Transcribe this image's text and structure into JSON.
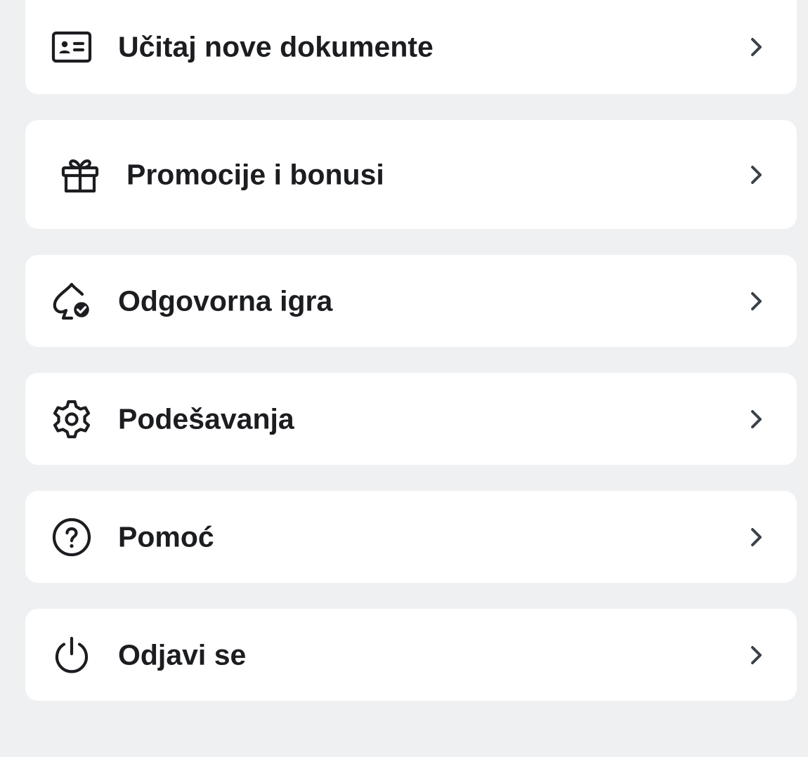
{
  "menu": {
    "items": [
      {
        "label": "Učitaj nove dokumente",
        "icon": "id-card-icon"
      },
      {
        "label": "Promocije i bonusi",
        "icon": "gift-icon"
      },
      {
        "label": "Odgovorna igra",
        "icon": "responsible-gaming-icon"
      },
      {
        "label": "Podešavanja",
        "icon": "gear-icon"
      },
      {
        "label": "Pomoć",
        "icon": "help-icon"
      },
      {
        "label": "Odjavi se",
        "icon": "power-icon"
      }
    ]
  },
  "colors": {
    "background": "#eff0f2",
    "card": "#ffffff",
    "text": "#1c1d20",
    "chevron": "#3b4149"
  }
}
